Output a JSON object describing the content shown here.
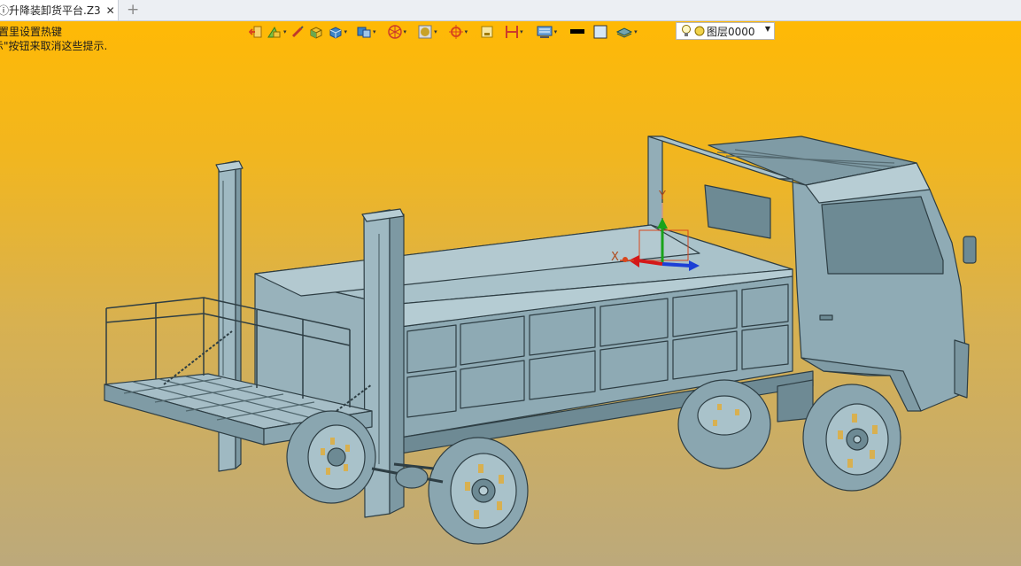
{
  "tab": {
    "title": "ⓘ升降装卸货平台.Z3",
    "close": "✕",
    "add": "+"
  },
  "hints": {
    "line1": "置里设置热键",
    "line2": "示\"按钮来取消这些提示."
  },
  "toolbar": {
    "items": [
      "exit-icon",
      "draft-icon",
      "sketch-pen-icon",
      "box-solid-icon",
      "box-shaded-icon",
      "view-cube-icon",
      "filter-icon",
      "render-icon",
      "snap-icon",
      "frame-icon",
      "align-icon",
      "display-icon",
      "color-swatch-icon",
      "frame-swatch-icon",
      "layer-stack-icon"
    ],
    "layer_combo": {
      "value": "图层0000"
    }
  },
  "triad": {
    "x_label": "X",
    "y_label": "Y"
  },
  "colors": {
    "bg_top": "#ffb905",
    "bg_bottom": "#bca97b",
    "body": "#8aa6b0",
    "edge": "#2e3e44"
  }
}
